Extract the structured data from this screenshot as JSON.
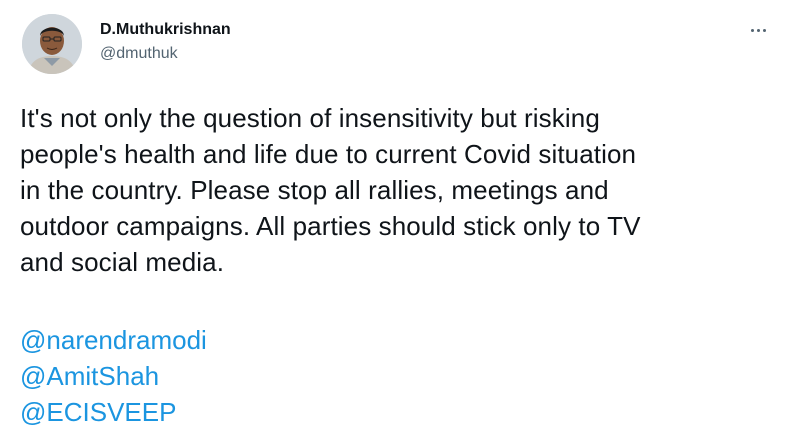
{
  "author": {
    "display_name": "D.Muthukrishnan",
    "handle": "@dmuthuk"
  },
  "tweet": {
    "lines": [
      "It's not only the question of insensitivity but risking",
      "people's health and life due to current Covid situation",
      "in the country. Please stop all rallies, meetings and",
      "outdoor campaigns. All parties should stick only to TV",
      "and social media."
    ],
    "mentions": [
      "@narendramodi",
      "@AmitShah",
      "@ECISVEEP"
    ]
  },
  "colors": {
    "text": "#0f1419",
    "secondary": "#536471",
    "link": "#1b95e0"
  },
  "icons": {
    "more": "more-horizontal-icon"
  }
}
